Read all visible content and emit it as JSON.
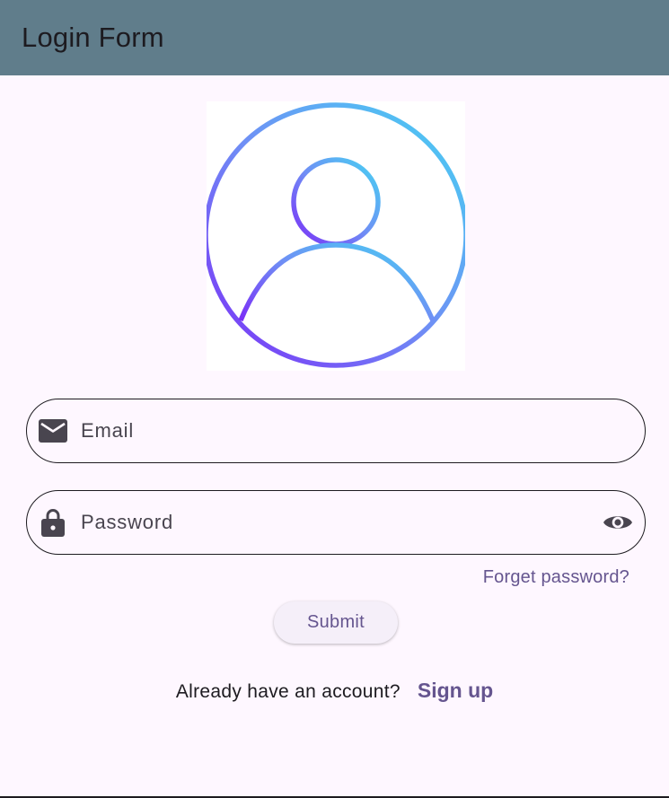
{
  "app_bar": {
    "title": "Login Form",
    "background": "#607d8b"
  },
  "avatar": {
    "icon": "user-circle-icon",
    "gradient": [
      "#4dd0f0",
      "#6f8ff5",
      "#7b2ff7"
    ]
  },
  "email_field": {
    "placeholder": "Email",
    "value": "",
    "icon": "mail-icon"
  },
  "password_field": {
    "placeholder": "Password",
    "value": "",
    "icon": "lock-icon",
    "toggle_icon": "eye-icon"
  },
  "forgot_password": {
    "label": "Forget password?"
  },
  "submit_button": {
    "label": "Submit"
  },
  "signup": {
    "prompt": "Already have an account?",
    "link_label": "Sign up"
  },
  "colors": {
    "background": "#fef7ff",
    "primary": "#65558f",
    "text": "#1d1b20",
    "icon": "#49454f"
  }
}
